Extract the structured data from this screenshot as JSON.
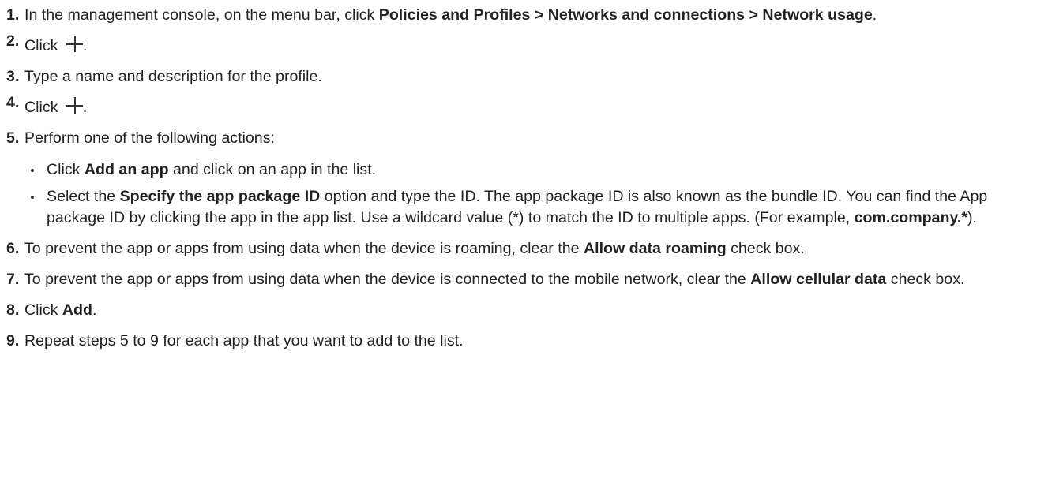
{
  "steps": [
    {
      "num": "1.",
      "parts": [
        {
          "t": "In the management console, on the menu bar, click "
        },
        {
          "t": "Policies and Profiles > Networks and connections > Network usage",
          "b": true
        },
        {
          "t": "."
        }
      ]
    },
    {
      "num": "2.",
      "icon": "plus-icon",
      "parts": [
        {
          "t": "Click "
        },
        {
          "icon": "plus-icon"
        },
        {
          "t": "."
        }
      ]
    },
    {
      "num": "3.",
      "parts": [
        {
          "t": "Type a name and description for the profile."
        }
      ]
    },
    {
      "num": "4.",
      "icon": "plus-icon",
      "parts": [
        {
          "t": "Click "
        },
        {
          "icon": "plus-icon"
        },
        {
          "t": "."
        }
      ]
    },
    {
      "num": "5.",
      "parts": [
        {
          "t": "Perform one of the following actions:"
        }
      ],
      "bullets": [
        [
          {
            "t": "Click "
          },
          {
            "t": "Add an app",
            "b": true
          },
          {
            "t": " and click on an app in the list."
          }
        ],
        [
          {
            "t": "Select the "
          },
          {
            "t": "Specify the app package ID",
            "b": true
          },
          {
            "t": " option and type the ID. The app package ID is also known as the bundle ID. You can find the App package ID by clicking the app in the app list. Use a wildcard value (*) to match the ID to multiple apps. (For example, "
          },
          {
            "t": "com.company.*",
            "b": true
          },
          {
            "t": ")."
          }
        ]
      ]
    },
    {
      "num": "6.",
      "parts": [
        {
          "t": "To prevent the app or apps from using data when the device is roaming, clear the "
        },
        {
          "t": "Allow data roaming",
          "b": true
        },
        {
          "t": " check box."
        }
      ]
    },
    {
      "num": "7.",
      "parts": [
        {
          "t": "To prevent the app or apps from using data when the device is connected to the mobile network, clear the "
        },
        {
          "t": "Allow cellular data",
          "b": true
        },
        {
          "t": " check box."
        }
      ]
    },
    {
      "num": "8.",
      "parts": [
        {
          "t": "Click "
        },
        {
          "t": "Add",
          "b": true
        },
        {
          "t": "."
        }
      ]
    },
    {
      "num": "9.",
      "parts": [
        {
          "t": "Repeat steps 5 to 9 for each app that you want to add to the list."
        }
      ]
    }
  ]
}
